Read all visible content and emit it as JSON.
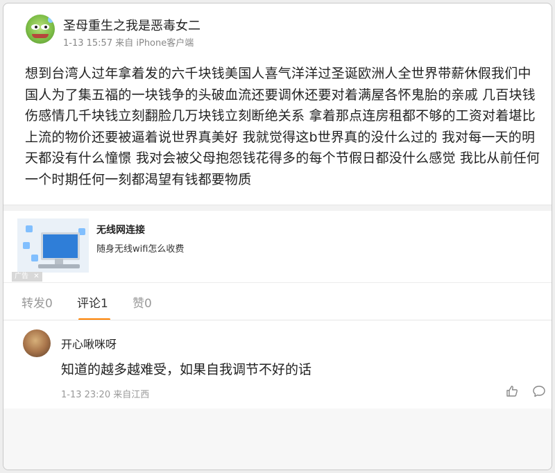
{
  "post": {
    "author": "圣母重生之我是恶毒女二",
    "meta": "1-13 15:57 来自 iPhone客户端",
    "text": "想到台湾人过年拿着发的六千块钱美国人喜气洋洋过圣诞欧洲人全世界带薪休假我们中国人为了集五福的一块钱争的头破血流还要调休还要对着满屋各怀鬼胎的亲戚 几百块钱伤感情几千块钱立刻翻脸几万块钱立刻断绝关系 拿着那点连房租都不够的工资对着堪比上流的物价还要被逼着说世界真美好 我就觉得这b世界真的没什么过的 我对每一天的明天都没有什么憧憬 我对会被父母抱怨钱花得多的每个节假日都没什么感觉 我比从前任何一个时期任何一刻都渴望有钱都要物质"
  },
  "ad": {
    "title": "无线网连接",
    "desc": "随身无线wifi怎么收费",
    "badge": "广告",
    "badge_close": "✕"
  },
  "tabs": [
    {
      "label": "转发0",
      "active": false
    },
    {
      "label": "评论1",
      "active": true
    },
    {
      "label": "赞0",
      "active": false
    }
  ],
  "comment": {
    "name": "开心啾咪呀",
    "text": "知道的越多越难受，如果自我调节不好的话",
    "meta": "1-13 23:20 来自江西",
    "like_icon": "thumb-up-icon",
    "reply_icon": "comment-bubble-icon"
  },
  "colors": {
    "accent": "#ff8200",
    "text_primary": "#222222",
    "text_secondary": "#999999"
  }
}
